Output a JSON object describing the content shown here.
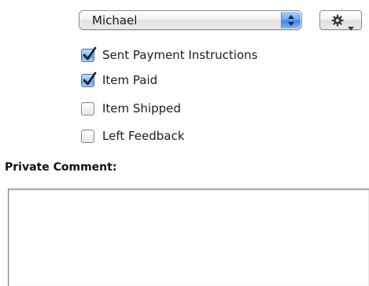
{
  "popup": {
    "selected": "Michael"
  },
  "action_button": {
    "icon": "gear-icon"
  },
  "checklist": [
    {
      "label": "Sent Payment Instructions",
      "checked": true
    },
    {
      "label": "Item Paid",
      "checked": true
    },
    {
      "label": "Item Shipped",
      "checked": false
    },
    {
      "label": "Left Feedback",
      "checked": false
    }
  ],
  "comment": {
    "label": "Private Comment:",
    "value": ""
  },
  "colors": {
    "accent": "#5e9ce8",
    "check_mark": "#1a1a1a"
  }
}
